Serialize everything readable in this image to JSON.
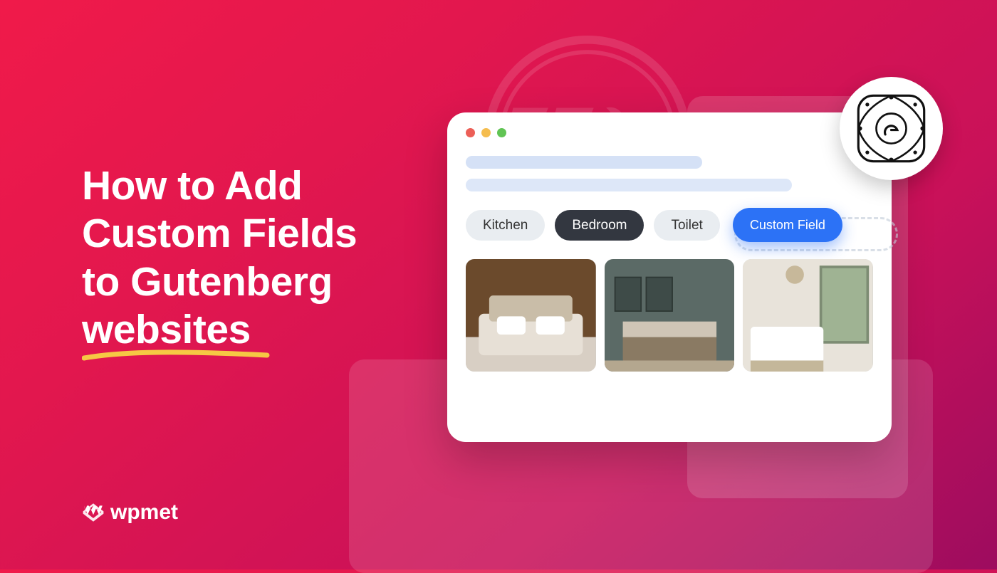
{
  "headline": {
    "line1": "How to Add",
    "line2": "Custom Fields",
    "line3": "to Gutenberg",
    "line4": "websites"
  },
  "brand": {
    "name": "wpmet"
  },
  "chips": {
    "kitchen": "Kitchen",
    "bedroom": "Bedroom",
    "toilet": "Toilet",
    "custom": "Custom Field"
  },
  "icons": {
    "wordpress": "wordpress-logo",
    "gutenberg": "gutenberg-logo",
    "cursor": "cursor-pointer"
  }
}
